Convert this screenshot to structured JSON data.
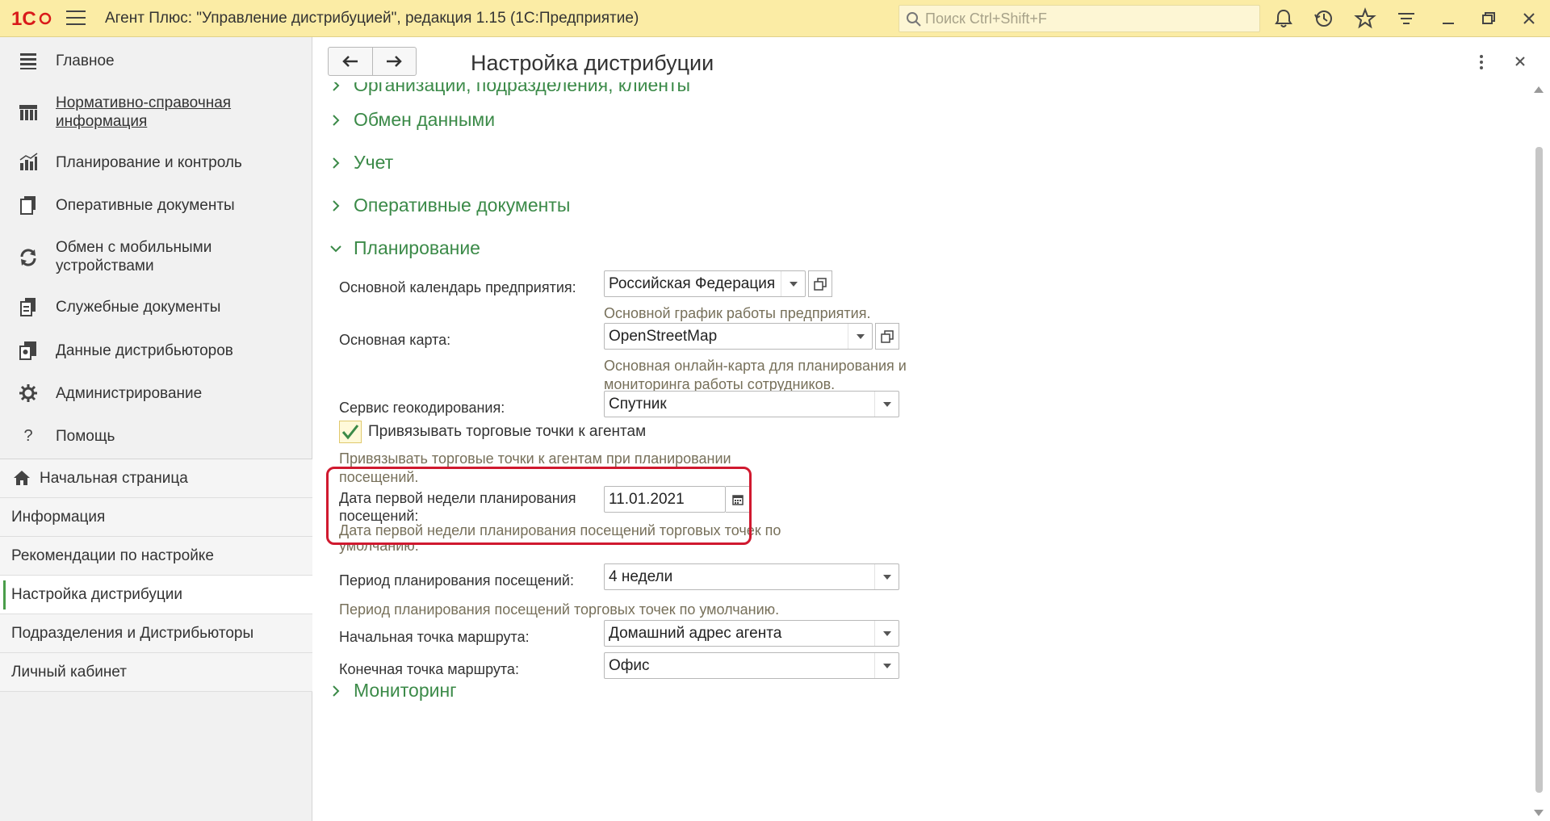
{
  "titlebar": {
    "logo_text": "1С",
    "app_title": "Агент Плюс: \"Управление дистрибуцией\", редакция 1.15  (1С:Предприятие)",
    "search_placeholder": "Поиск Ctrl+Shift+F"
  },
  "sidebar": {
    "sections": [
      {
        "label": "Главное",
        "icon": "menu-list-icon"
      },
      {
        "label": "Нормативно-справочная информация",
        "icon": "books-icon"
      },
      {
        "label": "Планирование и контроль",
        "icon": "bar-chart-icon"
      },
      {
        "label": "Оперативные документы",
        "icon": "documents-icon"
      },
      {
        "label": "Обмен с мобильными устройствами",
        "icon": "sync-icon"
      },
      {
        "label": "Служебные документы",
        "icon": "service-documents-icon"
      },
      {
        "label": "Данные дистрибьюторов",
        "icon": "distributor-data-icon"
      },
      {
        "label": "Администрирование",
        "icon": "gear-icon"
      },
      {
        "label": "Помощь",
        "icon": "help-icon"
      }
    ],
    "nav": [
      {
        "label": "Начальная страница"
      },
      {
        "label": "Информация"
      },
      {
        "label": "Рекомендации по настройке"
      },
      {
        "label": "Настройка дистрибуции"
      },
      {
        "label": "Подразделения и Дистрибьюторы"
      },
      {
        "label": "Личный кабинет"
      }
    ]
  },
  "main": {
    "title": "Настройка дистрибуции",
    "groups": {
      "org": "Организации, подразделения, клиенты",
      "exchange": "Обмен данными",
      "accounting": "Учет",
      "docs": "Оперативные документы",
      "planning": "Планирование",
      "monitoring": "Мониторинг"
    },
    "planning": {
      "calendar_label": "Основной календарь предприятия:",
      "calendar_value": "Российская Федерация",
      "calendar_hint": "Основной график работы предприятия.",
      "map_label": "Основная карта:",
      "map_value": "OpenStreetMap",
      "map_hint_1": "Основная онлайн-карта для планирования и",
      "map_hint_2": "мониторинга работы сотрудников.",
      "geo_label": "Сервис геокодирования:",
      "geo_value": "Спутник",
      "bind_label": "Привязывать торговые точки к агентам",
      "bind_hint_1": "Привязывать торговые точки к агентам при планировании",
      "bind_hint_2": "посещений.",
      "bind_checked": true,
      "date_label_1": "Дата первой недели планирования",
      "date_label_2": "посещений:",
      "date_value": "11.01.2021",
      "date_hint_1": "Дата первой недели планирования посещений торговых точек по",
      "date_hint_2": "умолчанию.",
      "period_label": "Период планирования посещений:",
      "period_value": "4 недели",
      "period_hint": "Период планирования посещений торговых точек по умолчанию.",
      "start_label": "Начальная точка маршрута:",
      "start_value": "Домашний адрес агента",
      "end_label": "Конечная точка маршрута:",
      "end_value": "Офис"
    }
  },
  "colors": {
    "titlebar": "#fbeca5",
    "group_link": "#3b8a48",
    "hint": "#77705a",
    "highlight": "#d0192f",
    "logo": "#d91a1a"
  }
}
